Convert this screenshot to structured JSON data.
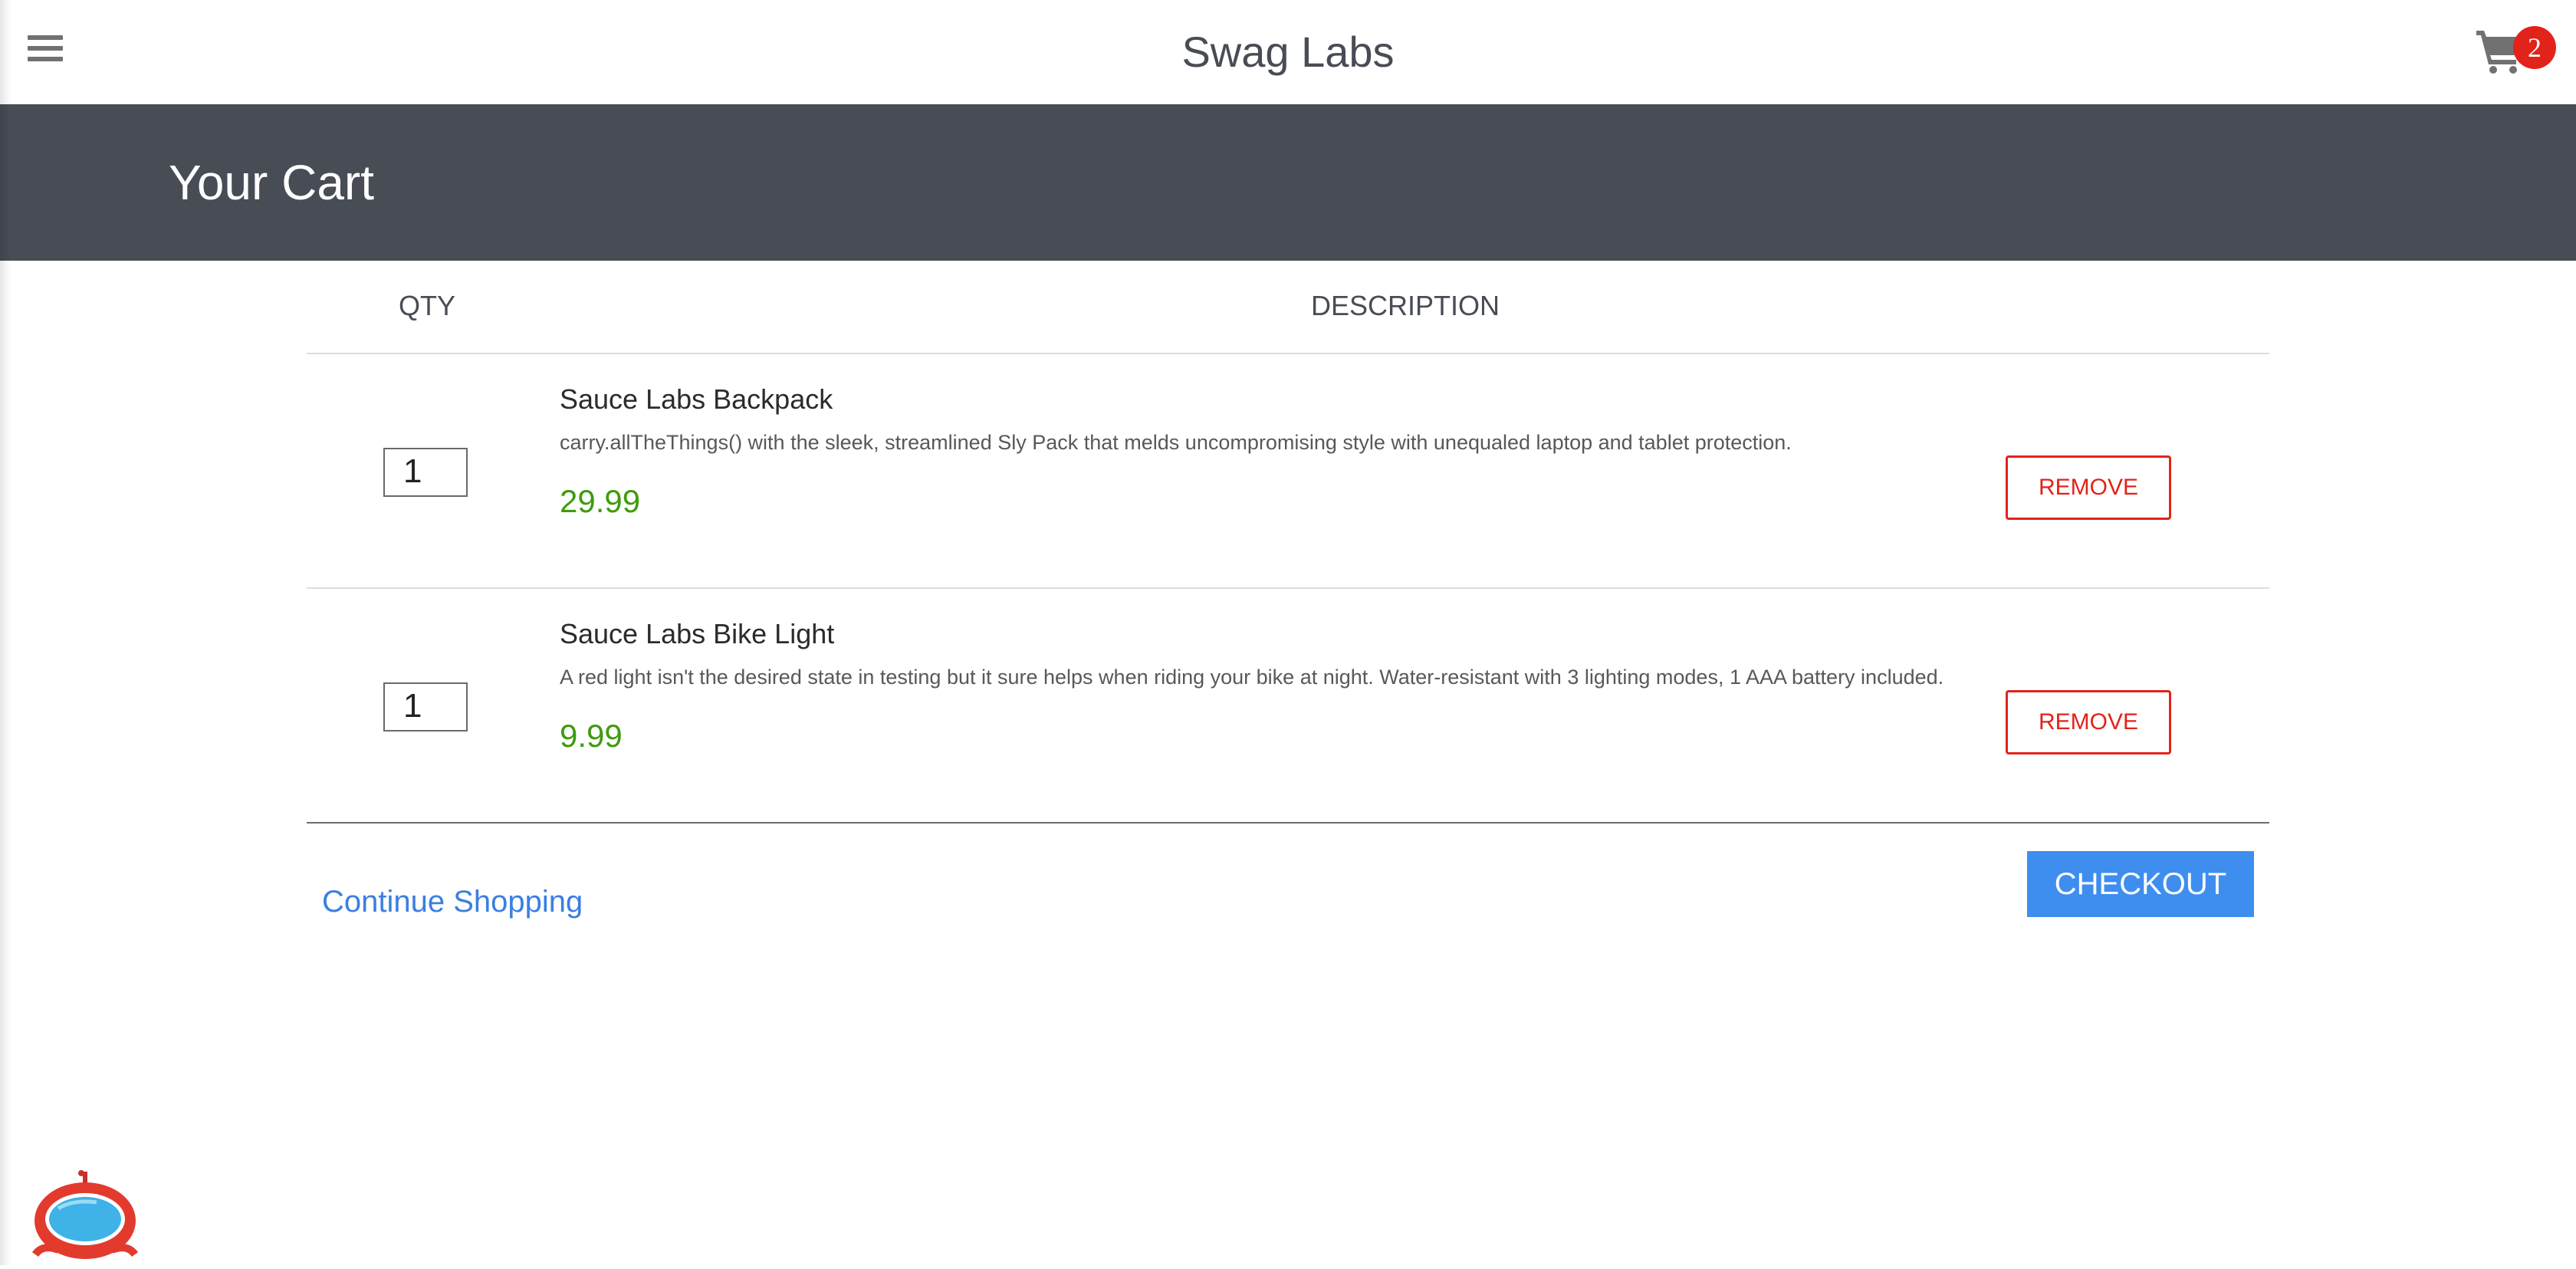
{
  "header": {
    "title": "Swag Labs",
    "cart_count": "2"
  },
  "subheader": {
    "title": "Your Cart"
  },
  "cart": {
    "qty_header": "QTY",
    "description_header": "DESCRIPTION",
    "items": [
      {
        "quantity": "1",
        "name": "Sauce Labs Backpack",
        "description": "carry.allTheThings() with the sleek, streamlined Sly Pack that melds uncompromising style with unequaled laptop and tablet protection.",
        "price": "29.99",
        "remove_label": "REMOVE"
      },
      {
        "quantity": "1",
        "name": "Sauce Labs Bike Light",
        "description": "A red light isn't the desired state in testing but it sure helps when riding your bike at night. Water-resistant with 3 lighting modes, 1 AAA battery included.",
        "price": "9.99",
        "remove_label": "REMOVE"
      }
    ]
  },
  "actions": {
    "continue_label": "Continue Shopping",
    "checkout_label": "CHECKOUT"
  },
  "icons": {
    "menu": "hamburger-menu-icon",
    "cart": "shopping-cart-icon",
    "mascot": "robot-mascot-icon"
  },
  "colors": {
    "subheader_bg": "#474c55",
    "price_green": "#3e9b0e",
    "remove_red": "#e2231a",
    "checkout_blue": "#3e8ef0",
    "link_blue": "#3b7fe0",
    "badge_red": "#e2231a"
  }
}
